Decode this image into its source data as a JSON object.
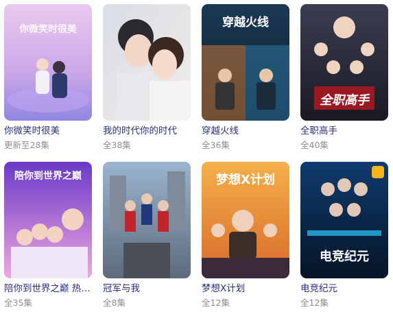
{
  "shows": [
    {
      "title": "你微笑时很美",
      "episodes": "更新至28集",
      "poster_title": "你微笑时很美"
    },
    {
      "title": "我的时代你的时代",
      "episodes": "全38集",
      "poster_title": ""
    },
    {
      "title": "穿越火线",
      "episodes": "全36集",
      "poster_title": "穿越火线"
    },
    {
      "title": "全职高手",
      "episodes": "全40集",
      "poster_title": "全职高手"
    },
    {
      "title": "陪你到世界之巅 热…",
      "episodes": "全35集",
      "poster_title": "陪你到世界之巅"
    },
    {
      "title": "冠军与我",
      "episodes": "全8集",
      "poster_title": ""
    },
    {
      "title": "梦想X计划",
      "episodes": "全12集",
      "poster_title": "梦想X计划"
    },
    {
      "title": "电竞纪元",
      "episodes": "全12集",
      "poster_title": "电竞纪元"
    }
  ],
  "colors": {
    "title_text": "#2a2e78",
    "meta_text": "#8e8e93"
  }
}
